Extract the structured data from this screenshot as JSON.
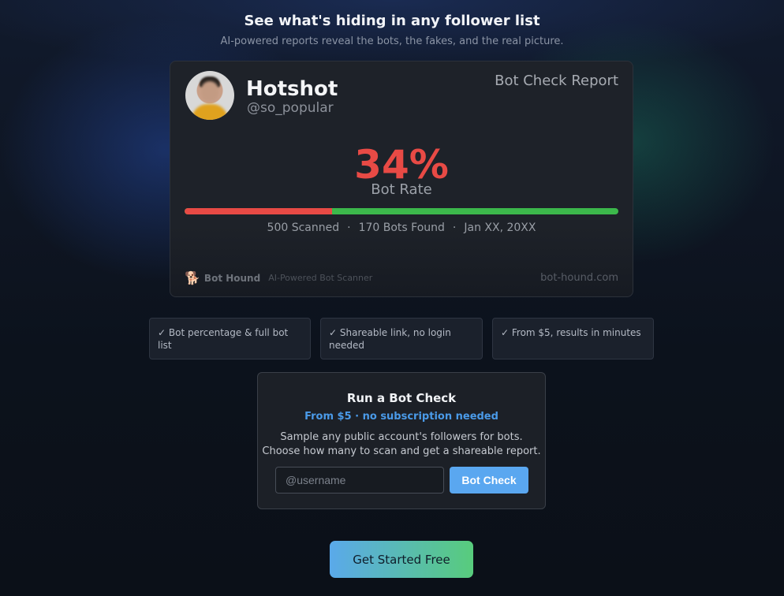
{
  "header": {
    "headline": "See what's hiding in any follower list",
    "subline": "AI-powered reports reveal the bots, the fakes, and the real picture."
  },
  "report_card": {
    "display_name": "Hotshot",
    "handle": "@so_popular",
    "title": "Bot Check Report",
    "bot_rate_text": "34%",
    "bot_rate_fraction": 0.34,
    "bot_rate_label": "Bot Rate",
    "scanned": "500 Scanned",
    "bots_found": "170 Bots Found",
    "date": "Jan XX, 20XX",
    "separator": "·",
    "brand_name": "Bot Hound",
    "brand_tagline": "AI-Powered Bot Scanner",
    "site": "bot-hound.com",
    "colors": {
      "bot": "#e84a45",
      "real": "#3cb84b"
    }
  },
  "features": [
    {
      "text": "✓ Bot percentage & full bot list"
    },
    {
      "text": "✓ Shareable link, no login needed"
    },
    {
      "text": "✓ From $5, results in minutes"
    }
  ],
  "run_check": {
    "title": "Run a Bot Check",
    "subtitle": "From $5 · no subscription needed",
    "desc_line1": "Sample any public account's followers for bots.",
    "desc_line2": "Choose how many to scan and get a shareable report.",
    "input_placeholder": "@username",
    "button_label": "Bot Check",
    "accent": "#5aa7f0"
  },
  "cta": {
    "label": "Get Started Free"
  },
  "icons": {
    "brand": "dog-icon"
  }
}
